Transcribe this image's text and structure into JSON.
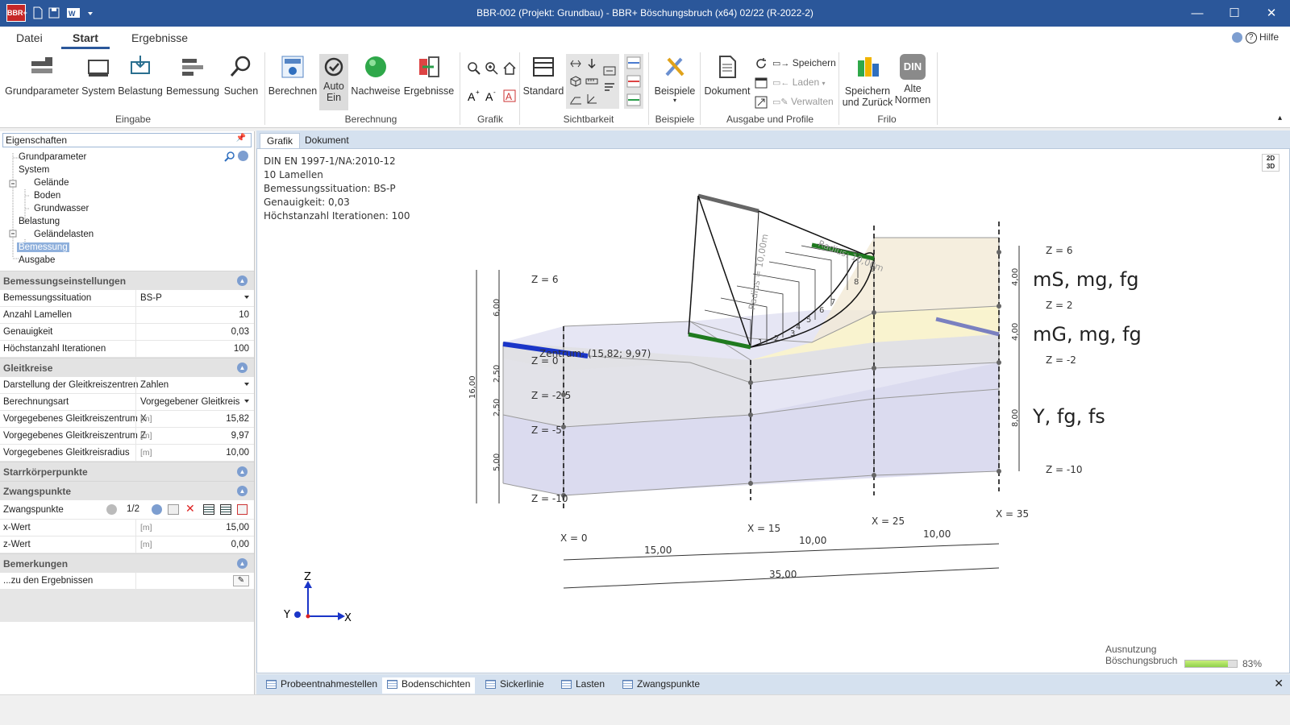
{
  "window": {
    "title": "BBR-002 (Projekt: Grundbau) - BBR+ Böschungsbruch (x64) 02/22 (R-2022-2)",
    "app_icon": "BBR+",
    "controls": [
      "—",
      "☐",
      "✕"
    ]
  },
  "ribbon_tabs": [
    "Datei",
    "Start",
    "Ergebnisse"
  ],
  "help_label": "Hilfe",
  "ribbon": {
    "buttons": {
      "grundparameter": "Grundparameter",
      "system": "System",
      "belastung": "Belastung",
      "bemessung": "Bemessung",
      "suchen": "Suchen",
      "berechnen": "Berechnen",
      "auto": "Auto",
      "ein": "Ein",
      "nachweise": "Nachweise",
      "ergebnisse": "Ergebnisse",
      "standard": "Standard",
      "beispiele": "Beispiele",
      "dokument": "Dokument",
      "speichern": "Speichern",
      "laden": "Laden",
      "verwalten": "Verwalten",
      "speichern_zurueck_1": "Speichern",
      "speichern_zurueck_2": "und Zurück",
      "alte_1": "Alte",
      "alte_2": "Normen",
      "din_badge": "DIN"
    },
    "groups": {
      "eingabe": "Eingabe",
      "berechnung": "Berechnung",
      "grafik": "Grafik",
      "sichtbarkeit": "Sichtbarkeit",
      "beispiele": "Beispiele",
      "ausgabe": "Ausgabe und Profile",
      "frilo": "Frilo"
    }
  },
  "properties": {
    "header": "Eigenschaften",
    "tree": {
      "grundparameter": "Grundparameter",
      "system": "System",
      "gelaende": "Gelände",
      "boden": "Boden",
      "grundwasser": "Grundwasser",
      "belastung": "Belastung",
      "gelaendelasten": "Geländelasten",
      "bemessung": "Bemessung",
      "ausgabe": "Ausgabe"
    },
    "sections": {
      "bemessungseinstellungen": "Bemessungseinstellungen",
      "gleitkreise": "Gleitkreise",
      "starrkoerper": "Starrkörperpunkte",
      "zwangspunkte": "Zwangspunkte",
      "bemerkungen": "Bemerkungen"
    },
    "rows": {
      "situation_label": "Bemessungssituation",
      "situation_value": "BS-P",
      "lamellen_label": "Anzahl Lamellen",
      "lamellen_value": "10",
      "genauigkeit_label": "Genauigkeit",
      "genauigkeit_value": "0,03",
      "iter_label": "Höchstanzahl Iterationen",
      "iter_value": "100",
      "darst_label": "Darstellung der Gleitkreiszentren",
      "darst_value": "Zahlen",
      "art_label": "Berechnungsart",
      "art_value": "Vorgegebener Gleitkreis",
      "gx_label": "Vorgegebenes Gleitkreiszentrum X",
      "gx_unit": "[m]",
      "gx_value": "15,82",
      "gz_label": "Vorgegebenes Gleitkreiszentrum Z",
      "gz_unit": "[m]",
      "gz_value": "9,97",
      "gr_label": "Vorgegebenes Gleitkreisradius",
      "gr_unit": "[m]",
      "gr_value": "10,00",
      "zp_label": "Zwangspunkte",
      "zp_nav": "1/2",
      "xw_label": "x-Wert",
      "xw_unit": "[m]",
      "xw_value": "15,00",
      "zw_label": "z-Wert",
      "zw_unit": "[m]",
      "zw_value": "0,00",
      "bem_label": "...zu den Ergebnissen"
    }
  },
  "doc_tabs": [
    "Grafik",
    "Dokument"
  ],
  "graphic": {
    "info": [
      "DIN EN 1997-1/NA:2010-12",
      "10 Lamellen",
      "Bemessungssituation: BS-P",
      "Genauigkeit: 0,03",
      "Höchstanzahl Iterationen: 100"
    ],
    "toggle": "2D 3D",
    "layers": [
      "mS, mg, fg",
      "mG, mg, fg",
      "Y, fg, fs"
    ],
    "z_right": [
      "Z = 6",
      "Z = 2",
      "Z = -2",
      "Z = -10"
    ],
    "z_left": [
      "Z = 6",
      "Z = 0",
      "Z = -2,5",
      "Z = -5",
      "Z = -10"
    ],
    "x_labels": [
      "X = 0",
      "X = 15",
      "X = 25",
      "X = 35"
    ],
    "dims_bottom": [
      "15,00",
      "10,00",
      "10,00",
      "35,00"
    ],
    "dims_left": [
      "6,00",
      "2,50",
      "2,50",
      "5,00",
      "16,00"
    ],
    "dims_right": [
      "4,00",
      "4,00",
      "8,00"
    ],
    "center_label": "Zentrum: (15,82; 9,97)",
    "radius_label": "Radius: 10,00m",
    "radius_label2": "Radius = 10,00m",
    "slice_numbers": [
      "1",
      "2",
      "3",
      "4",
      "5",
      "6",
      "7",
      "8",
      "9"
    ],
    "axes": [
      "Z",
      "Y",
      "X"
    ],
    "utilization": {
      "label1": "Ausnutzung",
      "label2": "Böschungsbruch",
      "percent_text": "83%",
      "fraction": 0.83
    }
  },
  "bottom_tabs": [
    "Probeentnahmestellen",
    "Bodenschichten",
    "Sickerlinie",
    "Lasten",
    "Zwangspunkte"
  ]
}
